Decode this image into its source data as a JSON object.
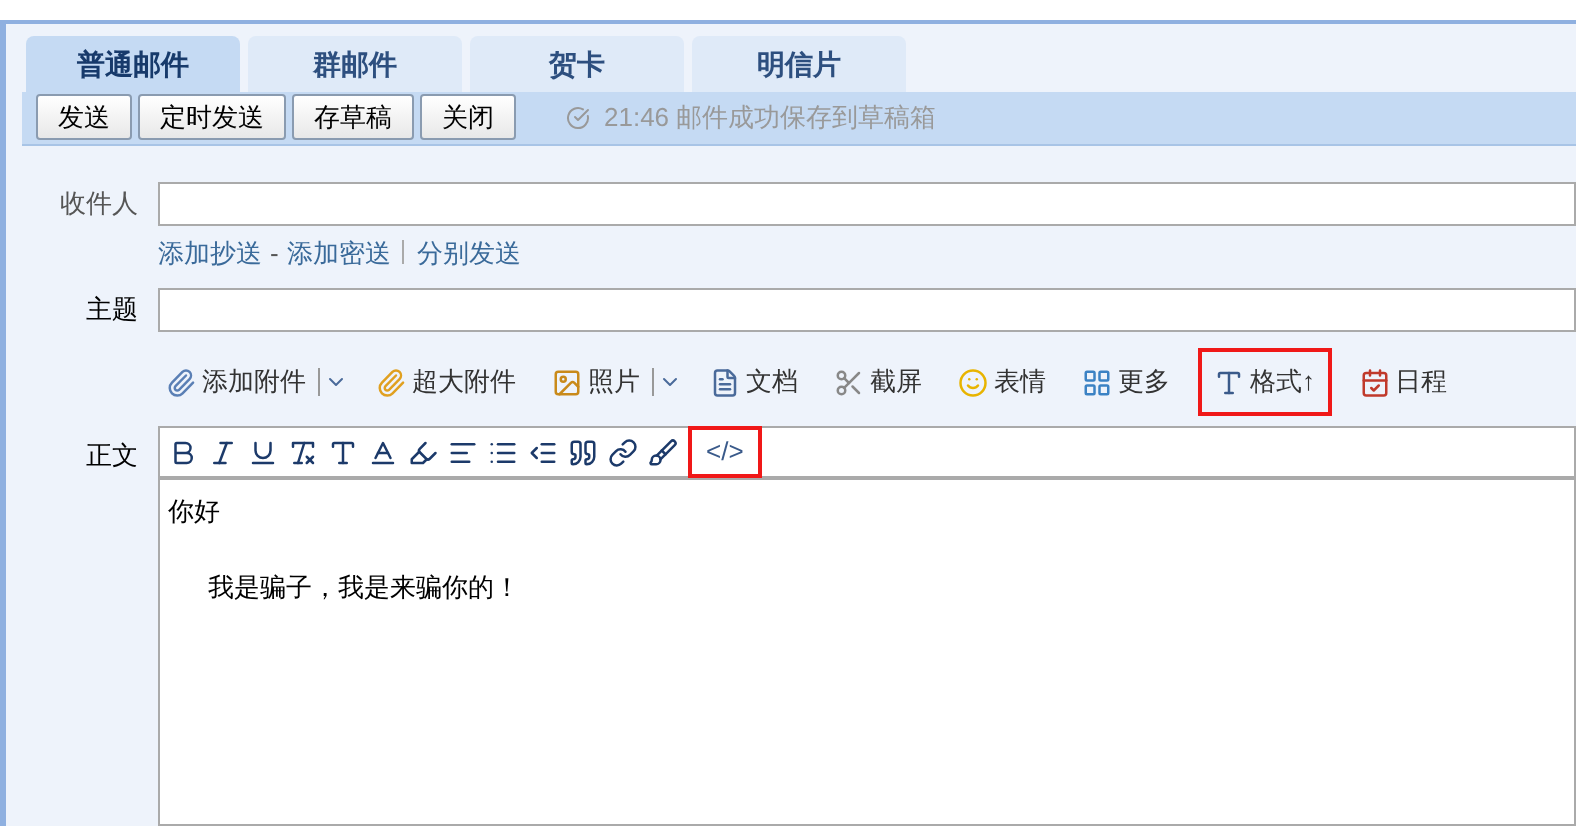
{
  "tabs": [
    {
      "label": "普通邮件",
      "selected": true
    },
    {
      "label": "群邮件",
      "selected": false
    },
    {
      "label": "贺卡",
      "selected": false
    },
    {
      "label": "明信片",
      "selected": false
    }
  ],
  "actions": [
    "发送",
    "定时发送",
    "存草稿",
    "关闭"
  ],
  "status": "21:46 邮件成功保存到草稿箱",
  "fields": {
    "recipient_label": "收件人",
    "cc_separator": "-",
    "cc_links": [
      {
        "label": "添加抄送"
      },
      {
        "label": "添加密送"
      },
      {
        "label": "分别发送"
      }
    ],
    "subject_label": "主题",
    "body_label": "正文"
  },
  "attach_toolbar": [
    {
      "kind": "paperclip",
      "label": "添加附件",
      "dropdown": true,
      "highlighted": false
    },
    {
      "kind": "big-clip",
      "label": "超大附件",
      "dropdown": false,
      "highlighted": false
    },
    {
      "kind": "photo",
      "label": "照片",
      "dropdown": true,
      "highlighted": false
    },
    {
      "kind": "document",
      "label": "文档",
      "dropdown": false,
      "highlighted": false
    },
    {
      "kind": "screenshot",
      "label": "截屏",
      "dropdown": false,
      "highlighted": false
    },
    {
      "kind": "emoji",
      "label": "表情",
      "dropdown": false,
      "highlighted": false
    },
    {
      "kind": "more",
      "label": "更多",
      "dropdown": false,
      "highlighted": false
    },
    {
      "kind": "format",
      "label": "格式↑",
      "dropdown": false,
      "highlighted": true
    },
    {
      "kind": "calendar",
      "label": "日程",
      "dropdown": false,
      "highlighted": false
    }
  ],
  "editor_toolbar": {
    "buttons": [
      {
        "kind": "bold"
      },
      {
        "kind": "italic"
      },
      {
        "kind": "underline"
      },
      {
        "kind": "clear-format"
      },
      {
        "kind": "font-size"
      },
      {
        "kind": "font-color"
      },
      {
        "kind": "highlight"
      },
      {
        "kind": "align"
      },
      {
        "kind": "list"
      },
      {
        "kind": "indent"
      },
      {
        "kind": "quote"
      },
      {
        "kind": "link"
      },
      {
        "kind": "brush"
      }
    ],
    "source_button": {
      "label": "</>",
      "highlighted": true
    }
  },
  "body_lines": [
    {
      "text": "你好",
      "indented": false
    },
    {
      "text": "我是骗子，我是来骗你的！",
      "indented": true
    }
  ]
}
